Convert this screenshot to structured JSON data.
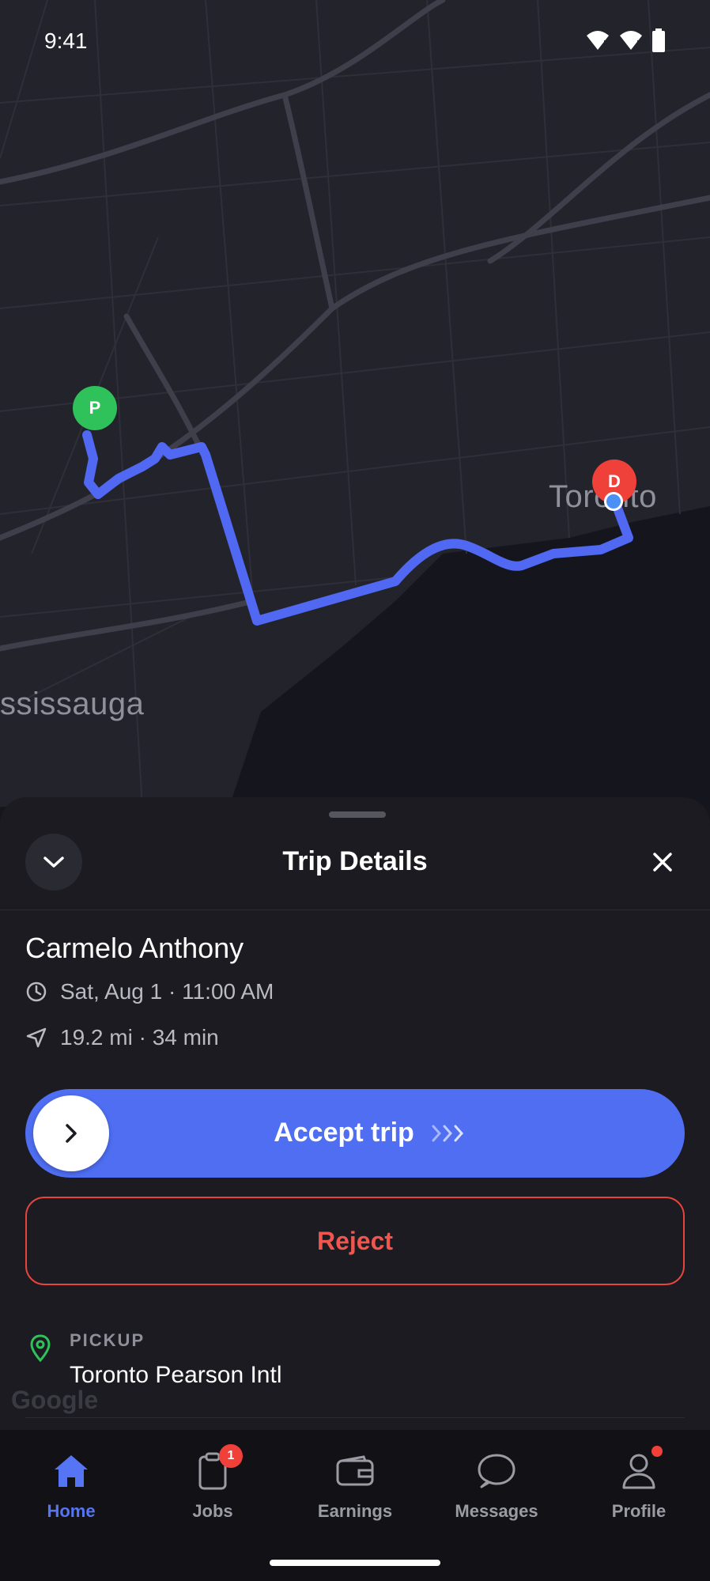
{
  "status_bar": {
    "time": "9:41"
  },
  "map": {
    "labels": {
      "city_east": "Toronto",
      "city_west": "ssissauga"
    },
    "pickup_pin": "P",
    "dropoff_pin": "D",
    "watermark": "Google",
    "colors": {
      "route": "#5068f2",
      "pickup": "#2fc15a",
      "dropoff": "#f0403a"
    }
  },
  "sheet": {
    "title": "Trip Details",
    "rider_name": "Carmelo Anthony",
    "datetime": "Sat, Aug 1 · 11:00 AM",
    "distance_time": "19.2 mi · 34 min",
    "accept_label": "Accept trip",
    "reject_label": "Reject",
    "pickup_label": "PICKUP",
    "pickup_value": "Toronto Pearson Intl"
  },
  "tabs": [
    {
      "label": "Home",
      "icon": "home-icon",
      "active": true
    },
    {
      "label": "Jobs",
      "icon": "clipboard-icon",
      "badge": "1"
    },
    {
      "label": "Earnings",
      "icon": "wallet-icon"
    },
    {
      "label": "Messages",
      "icon": "chat-icon"
    },
    {
      "label": "Profile",
      "icon": "person-icon",
      "dot": true
    }
  ],
  "colors": {
    "accent": "#4f6ef2",
    "danger": "#e5453d"
  }
}
